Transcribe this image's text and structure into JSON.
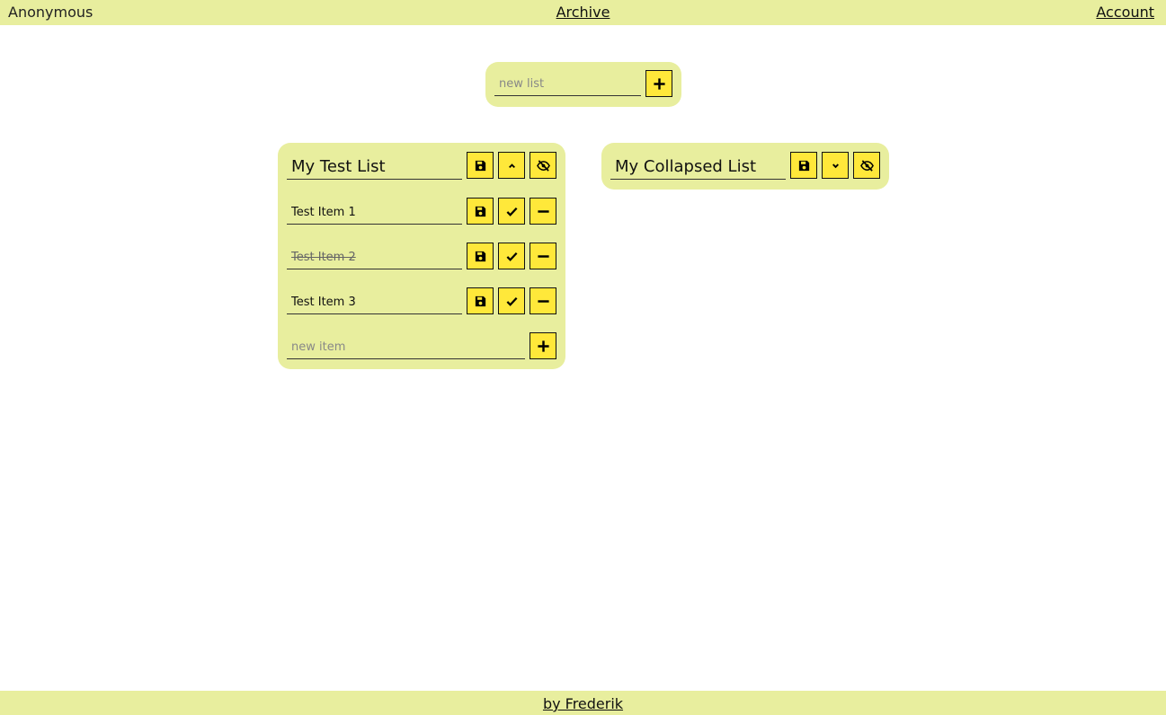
{
  "header": {
    "user": "Anonymous",
    "archive_link": "Archive",
    "account_link": "Account"
  },
  "new_list": {
    "placeholder": "new list",
    "add_icon": "plus-icon"
  },
  "lists": [
    {
      "title": "My Test List",
      "icons": {
        "save": "save-icon",
        "collapse": "chevron-up-icon",
        "hide": "eye-slash-icon"
      },
      "items": [
        {
          "text": "Test Item 1",
          "done": false
        },
        {
          "text": "Test Item 2",
          "done": true
        },
        {
          "text": "Test Item 3",
          "done": false
        }
      ],
      "item_icons": {
        "save": "save-icon",
        "check": "check-icon",
        "remove": "minus-icon"
      },
      "new_item_placeholder": "new item"
    },
    {
      "title": "My Collapsed List",
      "icons": {
        "save": "save-icon",
        "expand": "chevron-down-icon",
        "hide": "eye-slash-icon"
      }
    }
  ],
  "footer": {
    "credit_link": "by Frederik"
  },
  "colors": {
    "bar_background": "#e8ee9e",
    "button_yellow": "#ffe83a",
    "text": "#111111"
  }
}
